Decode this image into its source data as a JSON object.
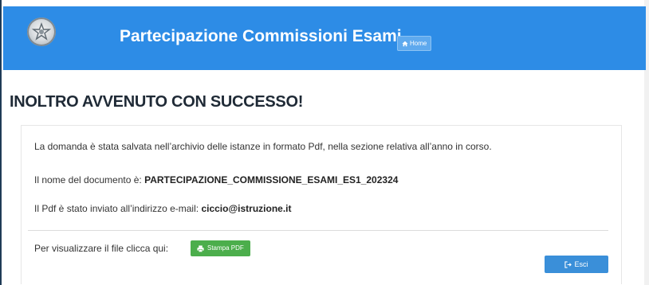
{
  "header": {
    "title": "Partecipazione Commissioni Esami",
    "home_label": "Home",
    "background_color": "#2d8ce6"
  },
  "main": {
    "heading": "INOLTRO AVVENUTO CON SUCCESSO!",
    "saved_message": "La domanda è stata salvata nell’archivio delle istanze in formato Pdf, nella sezione relativa all’anno in corso.",
    "doc_name_label": "Il nome del documento è:",
    "doc_name_value": "PARTECIPAZIONE_COMMISSIONE_ESAMI_ES1_202324",
    "email_label": "Il Pdf è stato inviato all’indirizzo e-mail:",
    "email_value": "ciccio@istruzione.it",
    "view_file_label": "Per visualizzare il file clicca qui:",
    "stampa_label": "Stampa PDF",
    "esci_label": "Esci"
  },
  "icons": {
    "emblem": "italian-republic-emblem",
    "home": "home-icon",
    "print": "print-icon",
    "logout": "sign-out-icon"
  },
  "colors": {
    "stampa_button": "#4cae4c",
    "esci_button": "#3a8fd9"
  }
}
